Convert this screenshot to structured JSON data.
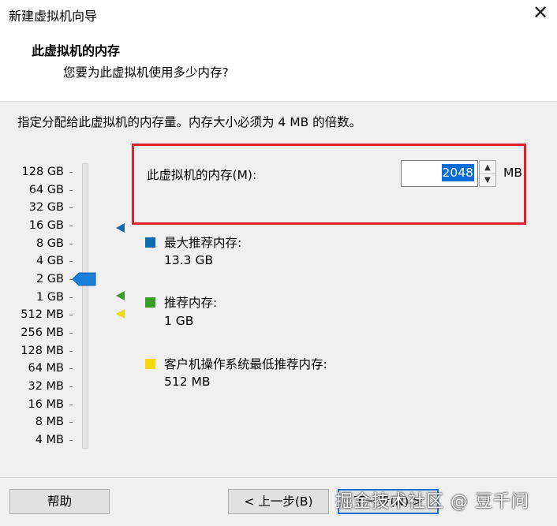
{
  "window": {
    "title": "新建虚拟机向导",
    "close_glyph": "✕"
  },
  "header": {
    "title": "此虚拟机的内存",
    "subtitle": "您要为此虚拟机使用多少内存?"
  },
  "instructions": "指定分配给此虚拟机的内存量。内存大小必须为 4 MB 的倍数。",
  "scale": {
    "labels": [
      "128 GB",
      "64 GB",
      "32 GB",
      "16 GB",
      "8 GB",
      "4 GB",
      "2 GB",
      "1 GB",
      "512 MB",
      "256 MB",
      "128 MB",
      "64 MB",
      "32 MB",
      "16 MB",
      "8 MB",
      "4 MB"
    ],
    "current_value": "2 GB"
  },
  "memory": {
    "label": "此虚拟机的内存(M):",
    "value": "2048",
    "unit": "MB",
    "spin_up": "▲",
    "spin_down": "▼"
  },
  "legend": {
    "max_recommended": {
      "title": "最大推荐内存:",
      "value": "13.3 GB",
      "color": "#0f6ab4"
    },
    "recommended": {
      "title": "推荐内存:",
      "value": "1 GB",
      "color": "#3a9b2b"
    },
    "guest_min": {
      "title": "客户机操作系统最低推荐内存:",
      "value": "512 MB",
      "color": "#f5d90a"
    }
  },
  "footer": {
    "help": "帮助",
    "back": "< 上一步(B)",
    "next": "下一步(N) >"
  },
  "watermark": "掘金技术社区 @ 豆千问",
  "colors": {
    "highlight_border": "#e0202a",
    "thumb": "#1a7fd8",
    "selection": "#0a6cd6"
  }
}
